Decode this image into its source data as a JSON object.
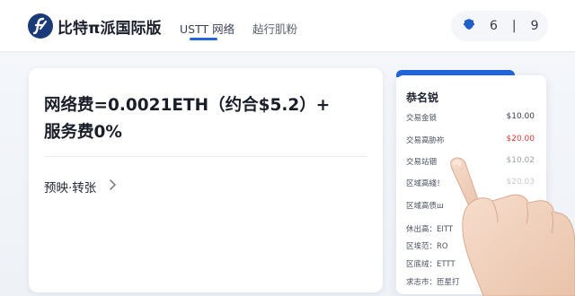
{
  "header": {
    "brand_name": "比特π派国际版",
    "tabs": [
      {
        "label": "USTT 网络",
        "active": true
      },
      {
        "label": "趈行肌粉",
        "active": false
      }
    ],
    "actions": {
      "item1": "6",
      "item2": "|",
      "item3": "9"
    },
    "icons": {
      "logo": "brand-logo-icon",
      "action": "shield-icon"
    },
    "accent_color": "#2466d9"
  },
  "main": {
    "fee_line_1": "网络费=0.0021ETH（约合$5.2）+",
    "fee_line_2": "服务费0%",
    "transfer_label": "预映·转张",
    "transfer_icon": "chevron-right-icon"
  },
  "side_panel": {
    "title": "恭名锐",
    "rows": [
      {
        "label": "交易金锁",
        "value": "$10.00",
        "tone": "normal"
      },
      {
        "label": "交易高胁袮",
        "value": "$20.00",
        "tone": "red"
      },
      {
        "label": "交易站锢",
        "value": "$10.02",
        "tone": "muted"
      },
      {
        "label": "区域高綫！",
        "value": "$20.03",
        "tone": "faint"
      },
      {
        "label": "区域高债ш",
        "value": "",
        "tone": "normal"
      },
      {
        "label": "休出高：EITT",
        "value": "",
        "tone": "normal"
      },
      {
        "label": "区埃范：RO",
        "value": "",
        "tone": "normal"
      },
      {
        "label": "区底绒：ETTT",
        "value": "",
        "tone": "normal"
      },
      {
        "label": "求志市：匝星打",
        "value": "",
        "tone": "normal"
      }
    ]
  }
}
